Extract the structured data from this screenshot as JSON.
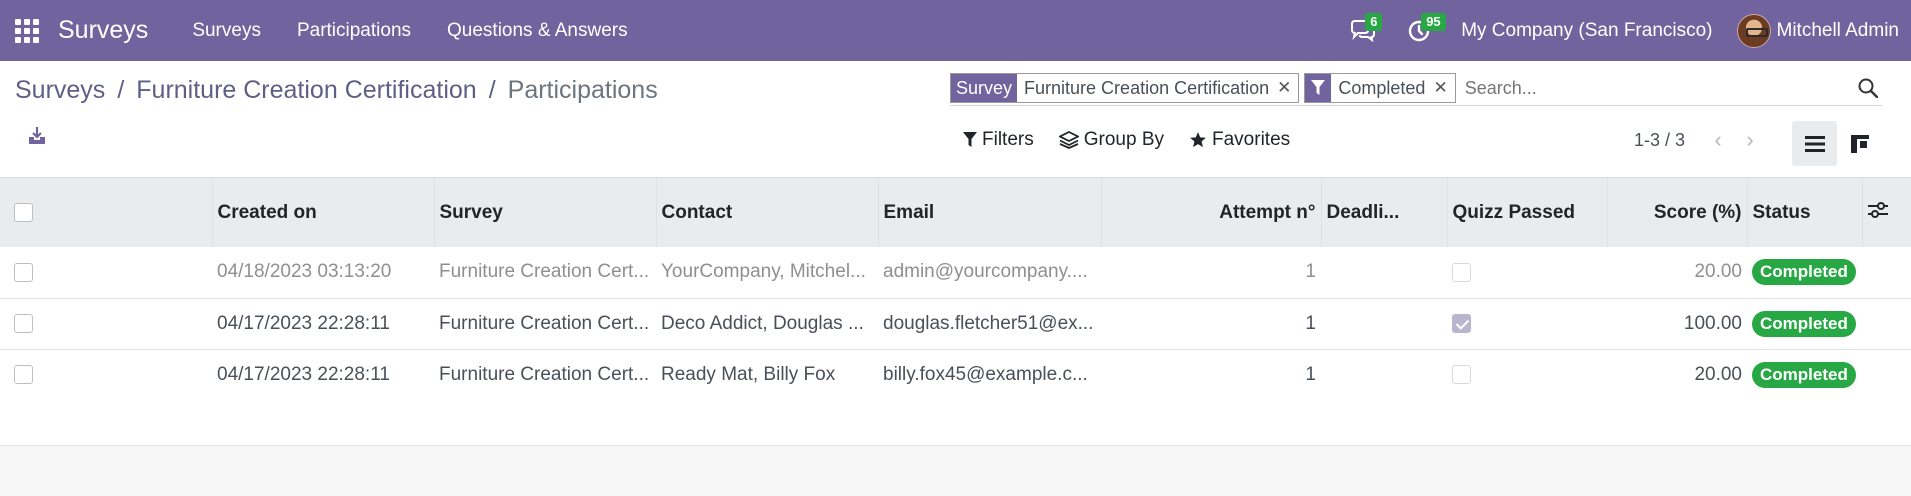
{
  "navbar": {
    "brand": "Surveys",
    "menu": [
      "Surveys",
      "Participations",
      "Questions & Answers"
    ],
    "messages_count": "6",
    "activities_count": "95",
    "company": "My Company (San Francisco)",
    "user": "Mitchell Admin",
    "bg_color": "#71639e"
  },
  "breadcrumb": {
    "items": [
      "Surveys",
      "Furniture Creation Certification",
      "Participations"
    ],
    "separator": "/"
  },
  "search": {
    "facets": [
      {
        "label": "Survey",
        "value": "Furniture Creation Certification"
      },
      {
        "label": "filter-icon",
        "value": "Completed"
      }
    ],
    "placeholder": "Search..."
  },
  "filters": {
    "filters_label": "Filters",
    "groupby_label": "Group By",
    "favorites_label": "Favorites"
  },
  "pager": {
    "value": "1-3 / 3"
  },
  "table": {
    "columns": [
      "Created on",
      "Survey",
      "Contact",
      "Email",
      "Attempt n°",
      "Deadli...",
      "Quizz Passed",
      "Score (%)",
      "Status"
    ],
    "rows": [
      {
        "created_on": "04/18/2023 03:13:20",
        "survey": "Furniture Creation Cert...",
        "contact": "YourCompany, Mitchel...",
        "email": "admin@yourcompany....",
        "attempt": "1",
        "deadline": "",
        "quizz_passed": false,
        "score": "20.00",
        "status": "Completed"
      },
      {
        "created_on": "04/17/2023 22:28:11",
        "survey": "Furniture Creation Cert...",
        "contact": "Deco Addict, Douglas ...",
        "email": "douglas.fletcher51@ex...",
        "attempt": "1",
        "deadline": "",
        "quizz_passed": true,
        "score": "100.00",
        "status": "Completed"
      },
      {
        "created_on": "04/17/2023 22:28:11",
        "survey": "Furniture Creation Cert...",
        "contact": "Ready Mat, Billy Fox",
        "email": "billy.fox45@example.c...",
        "attempt": "1",
        "deadline": "",
        "quizz_passed": false,
        "score": "20.00",
        "status": "Completed"
      }
    ]
  }
}
